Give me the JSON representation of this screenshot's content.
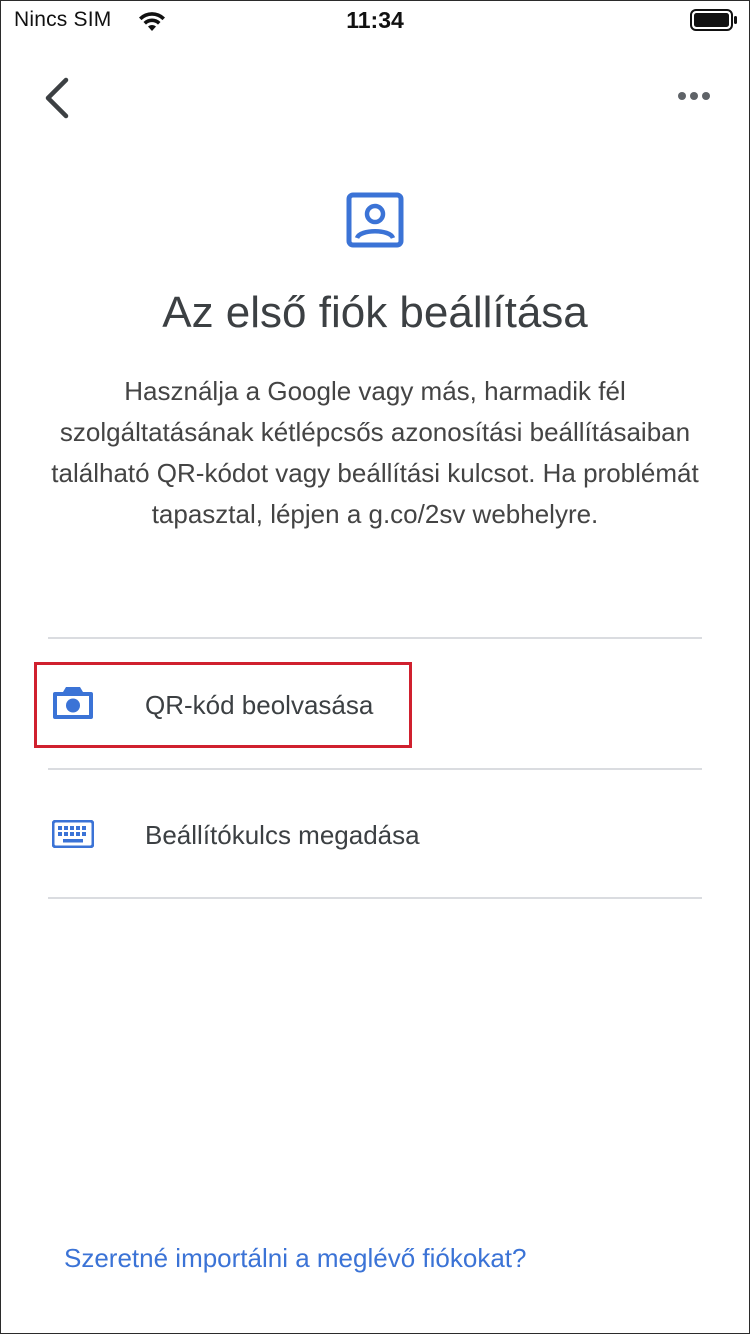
{
  "status_bar": {
    "carrier": "Nincs SIM",
    "time": "11:34",
    "wifi_icon": "wifi-icon",
    "battery_icon": "battery-icon"
  },
  "nav": {
    "back_icon": "chevron-left-icon",
    "more_icon": "more-horizontal-icon"
  },
  "header": {
    "icon": "account-box-icon",
    "title": "Az első fiók beállítása",
    "description": "Használja a Google vagy más, harmadik fél szolgáltatásának kétlépcsős azonosítási beállításaiban található QR-kódot vagy beállítási kulcsot. Ha problémát tapasztal, lépjen a g.co/2sv webhelyre."
  },
  "options": [
    {
      "icon": "camera-icon",
      "label": "QR-kód beolvasása"
    },
    {
      "icon": "keyboard-icon",
      "label": "Beállítókulcs megadása"
    }
  ],
  "footer": {
    "import_link": "Szeretné importálni a meglévő fiókokat?"
  },
  "colors": {
    "accent": "#3b73d6",
    "highlight_border": "#d0202e",
    "divider": "#dadce0",
    "text": "#3c4043"
  }
}
